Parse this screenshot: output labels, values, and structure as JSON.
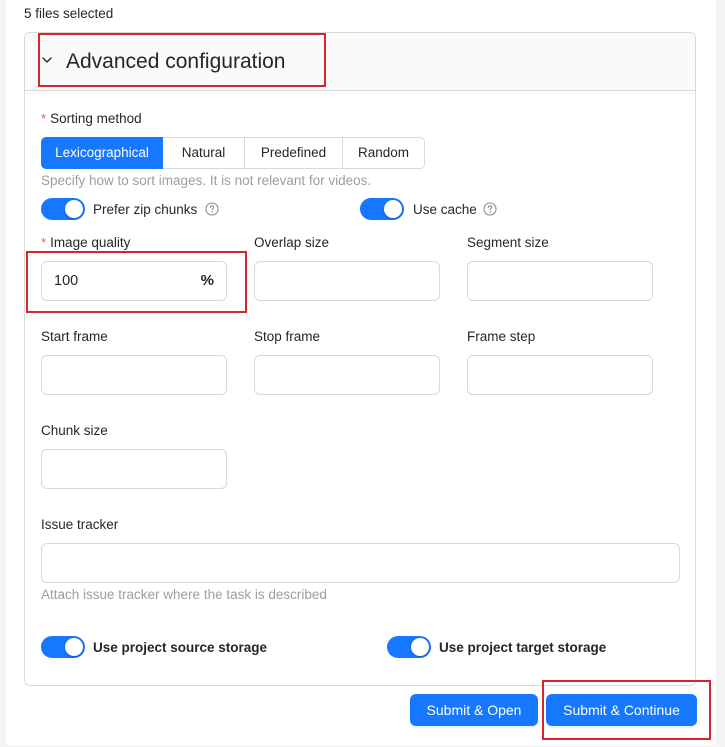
{
  "files_selected": "5 files selected",
  "advanced": {
    "title": "Advanced configuration",
    "sorting": {
      "label": "Sorting method",
      "options": [
        "Lexicographical",
        "Natural",
        "Predefined",
        "Random"
      ],
      "selected": "Lexicographical",
      "hint": "Specify how to sort images. It is not relevant for videos."
    },
    "prefer_zip_chunks": {
      "label": "Prefer zip chunks",
      "checked": true
    },
    "use_cache": {
      "label": "Use cache",
      "checked": true
    },
    "image_quality": {
      "label": "Image quality",
      "value": "100",
      "suffix": "%"
    },
    "overlap_size": {
      "label": "Overlap size",
      "value": ""
    },
    "segment_size": {
      "label": "Segment size",
      "value": ""
    },
    "start_frame": {
      "label": "Start frame",
      "value": ""
    },
    "stop_frame": {
      "label": "Stop frame",
      "value": ""
    },
    "frame_step": {
      "label": "Frame step",
      "value": ""
    },
    "chunk_size": {
      "label": "Chunk size",
      "value": ""
    },
    "issue_tracker": {
      "label": "Issue tracker",
      "value": "",
      "hint": "Attach issue tracker where the task is described"
    },
    "use_project_source_storage": {
      "label": "Use project source storage",
      "checked": true
    },
    "use_project_target_storage": {
      "label": "Use project target storage",
      "checked": true
    }
  },
  "actions": {
    "submit_open": "Submit & Open",
    "submit_continue": "Submit & Continue"
  },
  "colors": {
    "primary": "#1677ff",
    "required": "#ff4d4f",
    "highlight": "#d9242b"
  },
  "icons": {
    "collapse": "chevron-down-icon",
    "help": "question-circle-icon"
  }
}
